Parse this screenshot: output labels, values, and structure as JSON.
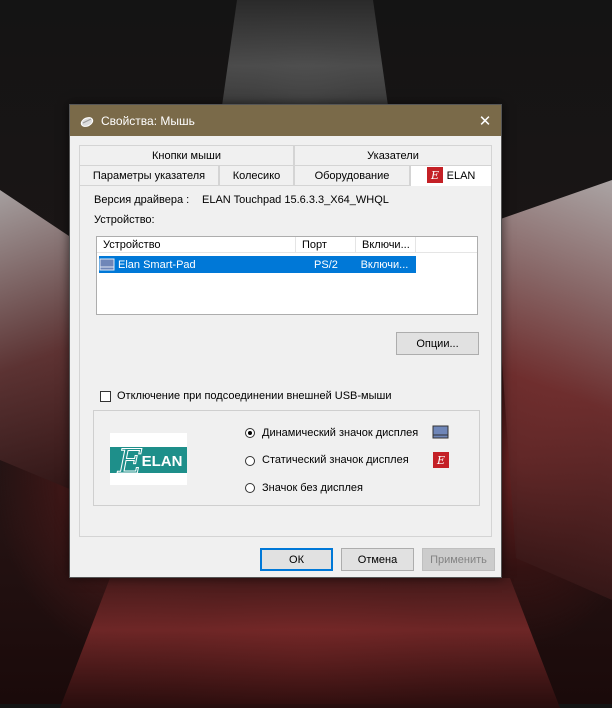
{
  "window": {
    "title": "Свойства: Мышь",
    "close": "✕"
  },
  "tabs_row1": [
    "Кнопки мыши",
    "Указатели"
  ],
  "tabs_row2": [
    "Параметры указателя",
    "Колесико",
    "Оборудование",
    "ELAN"
  ],
  "driver": {
    "label": "Версия драйвера :",
    "value": "ELAN Touchpad 15.6.3.3_X64_WHQL"
  },
  "device_label": "Устройство:",
  "table": {
    "headers": [
      "Устройство",
      "Порт",
      "Включи..."
    ],
    "rows": [
      {
        "device": "Elan Smart-Pad",
        "port": "PS/2",
        "enabled": "Включи..."
      }
    ]
  },
  "options_button": "Опции...",
  "usb_disable_checkbox": {
    "label": "Отключение при подсоединении внешней USB-мыши",
    "checked": false
  },
  "logo_text": "ELAN",
  "display_options": [
    {
      "label": "Динамический значок дисплея",
      "checked": true
    },
    {
      "label": "Статический значок дисплея",
      "checked": false
    },
    {
      "label": "Значок без дисплея",
      "checked": false
    }
  ],
  "buttons": {
    "ok": "ОК",
    "cancel": "Отмена",
    "apply": "Применить"
  },
  "colors": {
    "titlebar": "#7a6a49",
    "selection": "#0078d7",
    "elan_green": "#1e8f8a",
    "elan_red": "#c42026"
  }
}
